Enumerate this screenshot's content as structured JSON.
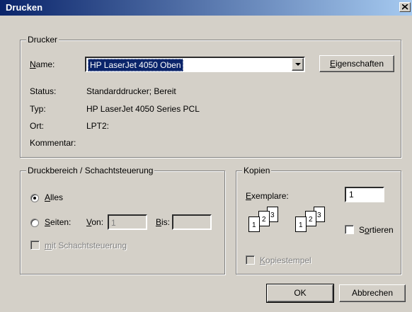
{
  "window": {
    "title": "Drucken"
  },
  "printer": {
    "group_label": "Drucker",
    "name_label": "Name:",
    "name_value": "HP LaserJet 4050 Oben",
    "properties_button": "Eigenschaften",
    "status_label": "Status:",
    "status_value": "Standarddrucker; Bereit",
    "type_label": "Typ:",
    "type_value": "HP LaserJet 4050 Series PCL",
    "location_label": "Ort:",
    "location_value": "LPT2:",
    "comment_label": "Kommentar:",
    "comment_value": ""
  },
  "range": {
    "group_label": "Druckbereich / Schachtsteuerung",
    "all_label": "Alles",
    "pages_label": "Seiten:",
    "from_label": "Von:",
    "from_value": "1",
    "to_label": "Bis:",
    "to_value": "",
    "tray_label": "mit Schachtsteuerung"
  },
  "copies": {
    "group_label": "Kopien",
    "copies_label": "Exemplare:",
    "copies_value": "1",
    "collate_label": "Sortieren",
    "stamp_label": "Kopiestempel",
    "page_numbers": [
      "1",
      "2",
      "3"
    ]
  },
  "footer": {
    "ok": "OK",
    "cancel": "Abbrechen"
  },
  "colors": {
    "title_start": "#0a246a",
    "title_end": "#a6caf0",
    "selection": "#0a246a",
    "face": "#d4d0c8"
  }
}
